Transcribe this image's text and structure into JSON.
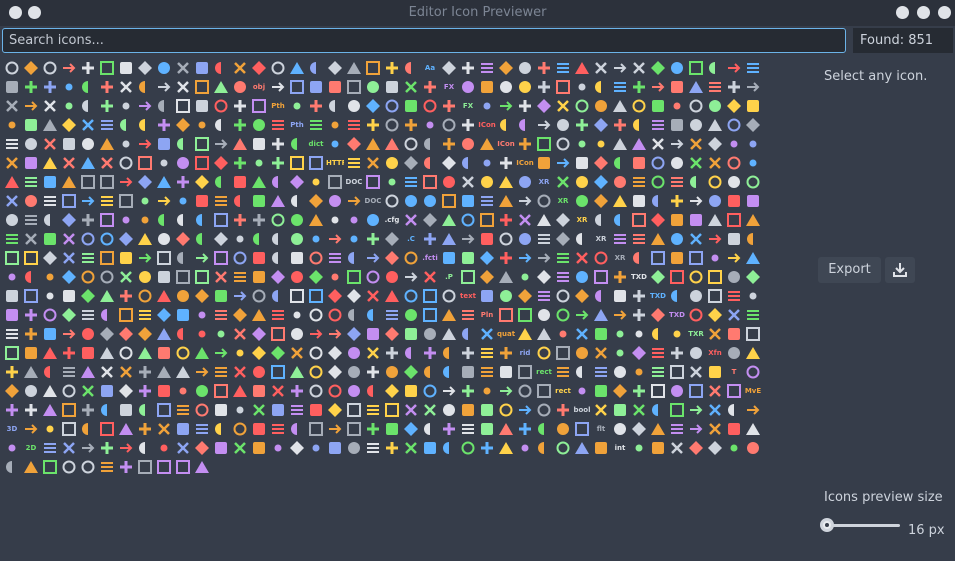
{
  "window": {
    "title": "Editor Icon Previewer"
  },
  "search": {
    "placeholder": "Search icons...",
    "value": ""
  },
  "found": {
    "label": "Found: 851"
  },
  "sidebar": {
    "select_hint": "Select any icon.",
    "export_label": "Export",
    "size_label": "Icons preview size",
    "size_value": "16 px",
    "size_fraction": 0.0
  },
  "icons": {
    "total": 851,
    "palette": [
      "#ff7a70",
      "#f0a23a",
      "#8da5f3",
      "#6be36b",
      "#ffd24a",
      "#cdd3dc",
      "#a6adb8",
      "#e0e3e8",
      "#5fb2ff",
      "#c38ef1",
      "#8eef97",
      "#ff5f5f"
    ],
    "visible_labels": [
      "obj",
      "Pth",
      "Pth",
      "dict",
      "HTTP",
      "DOC",
      "DOC",
      ".cfg",
      ".C",
      ".fcti",
      ".P",
      "text",
      "Pln",
      "quat",
      "rid",
      "rect",
      "rect",
      "bool",
      "flt",
      "int",
      "Aa",
      "FX",
      "FX",
      "ICon",
      "ICon",
      "ICon",
      "XR",
      "XR",
      "XR",
      "XR",
      "XR",
      "TXD",
      "TXD",
      "TXD",
      "TXR",
      "Xfn",
      "T",
      "MvE",
      "3D",
      "2D"
    ]
  }
}
